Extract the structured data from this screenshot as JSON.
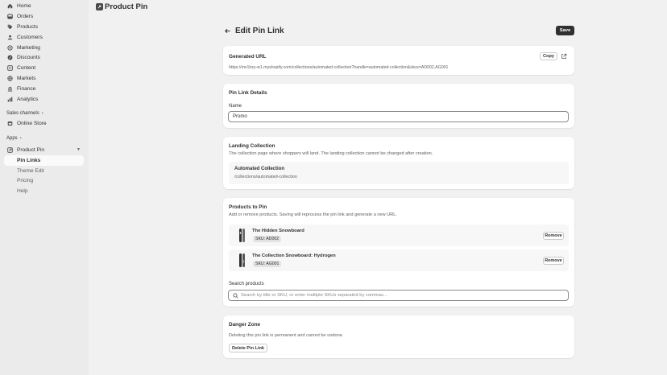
{
  "sidebar": {
    "items": [
      {
        "label": "Home",
        "icon": "home-icon"
      },
      {
        "label": "Orders",
        "icon": "orders-icon"
      },
      {
        "label": "Products",
        "icon": "tag-icon"
      },
      {
        "label": "Customers",
        "icon": "person-icon"
      },
      {
        "label": "Marketing",
        "icon": "target-icon"
      },
      {
        "label": "Discounts",
        "icon": "discount-icon"
      },
      {
        "label": "Content",
        "icon": "content-icon"
      },
      {
        "label": "Markets",
        "icon": "globe-icon"
      },
      {
        "label": "Finance",
        "icon": "bank-icon"
      },
      {
        "label": "Analytics",
        "icon": "chart-icon"
      }
    ],
    "sales_channels_label": "Sales channels",
    "online_store_label": "Online Store",
    "apps_label": "Apps",
    "app_name": "Product Pin",
    "app_sub_items": [
      "Pin Links",
      "Theme Edit",
      "Pricing",
      "Help"
    ]
  },
  "topbar": {
    "title": "Product Pin"
  },
  "page": {
    "title": "Edit Pin Link",
    "save_label": "Save"
  },
  "generated_url": {
    "title": "Generated URL",
    "url": "https://mv1hzy-w1.myshopify.com/collections/automated-collection?handle=automated-collection&skus=AD002,AG001",
    "copy_label": "Copy"
  },
  "details": {
    "title": "Pin Link Details",
    "name_label": "Name",
    "name_value": "Promo"
  },
  "landing": {
    "title": "Landing Collection",
    "description": "The collection page where shoppers will land. The landing collection cannot be changed after creation.",
    "collection_title": "Automated Collection",
    "collection_path": "/collections/automated-collection"
  },
  "products": {
    "title": "Products to Pin",
    "description": "Add or remove products. Saving will reprocess the pin link and generate a new URL.",
    "items": [
      {
        "name": "The Hidden Snowboard",
        "sku": "SKU: AD002",
        "remove_label": "Remove"
      },
      {
        "name": "The Collection Snowboard: Hydrogen",
        "sku": "SKU: AG001",
        "remove_label": "Remove"
      }
    ],
    "search_label": "Search products",
    "search_placeholder": "Search by title or SKU, or enter multiple SKUs separated by commas..."
  },
  "danger": {
    "title": "Danger Zone",
    "description": "Deleting this pin link is permanent and cannot be undone.",
    "delete_label": "Delete Pin Link"
  }
}
